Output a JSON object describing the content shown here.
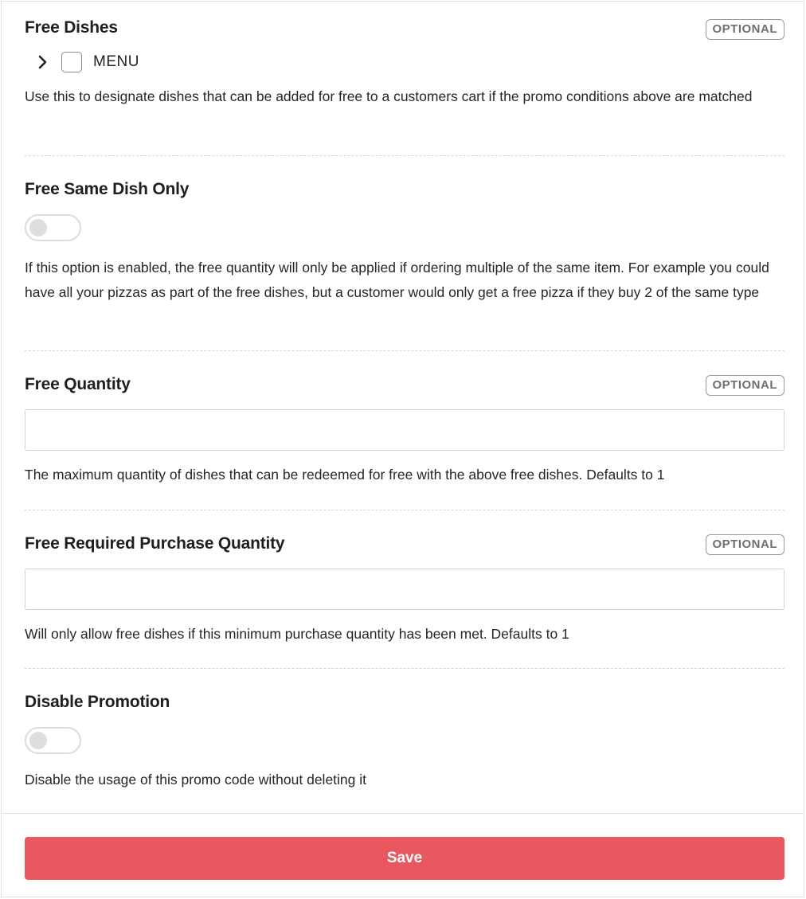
{
  "free_dishes": {
    "label": "Free Dishes",
    "badge": "OPTIONAL",
    "tree_item_label": "MENU",
    "help": "Use this to designate dishes that can be added for free to a customers cart if the promo conditions above are matched"
  },
  "free_same_dish_only": {
    "label": "Free Same Dish Only",
    "enabled": false,
    "help": "If this option is enabled, the free quantity will only be applied if ordering multiple of the same item. For example you could have all your pizzas as part of the free dishes, but a customer would only get a free pizza if they buy 2 of the same type"
  },
  "free_quantity": {
    "label": "Free Quantity",
    "badge": "OPTIONAL",
    "value": "",
    "help": "The maximum quantity of dishes that can be redeemed for free with the above free dishes. Defaults to 1"
  },
  "free_required_purchase_quantity": {
    "label": "Free Required Purchase Quantity",
    "badge": "OPTIONAL",
    "value": "",
    "help": "Will only allow free dishes if this minimum purchase quantity has been met. Defaults to 1"
  },
  "disable_promotion": {
    "label": "Disable Promotion",
    "enabled": false,
    "help": "Disable the usage of this promo code without deleting it"
  },
  "footer": {
    "save_label": "Save"
  },
  "colors": {
    "primary_button": "#e9585f",
    "badge_border": "#9a9a9a",
    "toggle_off": "#dedede"
  },
  "icons": {
    "expand": "chevron-right-icon",
    "checkbox": "checkbox-unchecked"
  }
}
